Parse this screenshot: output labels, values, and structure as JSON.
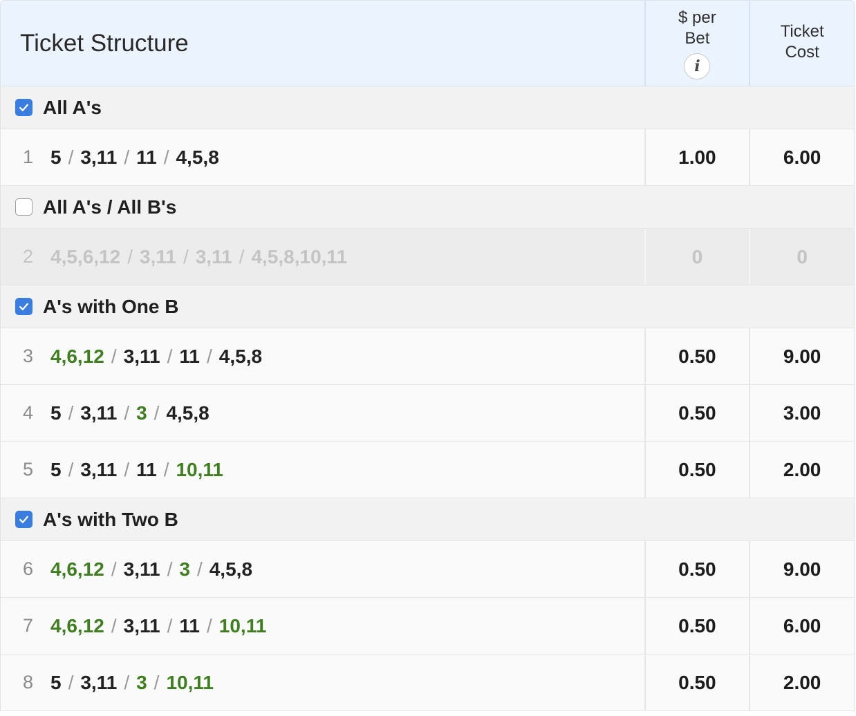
{
  "header": {
    "title": "Ticket Structure",
    "per_bet_line1": "$ per",
    "per_bet_line2": "Bet",
    "info_icon": "i",
    "cost_line1": "Ticket",
    "cost_line2": "Cost"
  },
  "colors": {
    "header_bg": "#ebf4fe",
    "checkbox_checked": "#3a7de0",
    "b_leg_green": "#3f7f1f"
  },
  "groups": [
    {
      "label": "All A's",
      "checked": true,
      "tickets": [
        {
          "num": "1",
          "legs": [
            {
              "t": "5",
              "b": false
            },
            {
              "t": "3,11",
              "b": false
            },
            {
              "t": "11",
              "b": false
            },
            {
              "t": "4,5,8",
              "b": false
            }
          ],
          "per_bet": "1.00",
          "cost": "6.00",
          "disabled": false
        }
      ]
    },
    {
      "label": "All A's / All B's",
      "checked": false,
      "tickets": [
        {
          "num": "2",
          "legs": [
            {
              "t": "4,5,6,12",
              "b": false
            },
            {
              "t": "3,11",
              "b": false
            },
            {
              "t": "3,11",
              "b": false
            },
            {
              "t": "4,5,8,10,11",
              "b": false
            }
          ],
          "per_bet": "0",
          "cost": "0",
          "disabled": true
        }
      ]
    },
    {
      "label": "A's with One B",
      "checked": true,
      "tickets": [
        {
          "num": "3",
          "legs": [
            {
              "t": "4,6,12",
              "b": true
            },
            {
              "t": "3,11",
              "b": false
            },
            {
              "t": "11",
              "b": false
            },
            {
              "t": "4,5,8",
              "b": false
            }
          ],
          "per_bet": "0.50",
          "cost": "9.00",
          "disabled": false
        },
        {
          "num": "4",
          "legs": [
            {
              "t": "5",
              "b": false
            },
            {
              "t": "3,11",
              "b": false
            },
            {
              "t": "3",
              "b": true
            },
            {
              "t": "4,5,8",
              "b": false
            }
          ],
          "per_bet": "0.50",
          "cost": "3.00",
          "disabled": false
        },
        {
          "num": "5",
          "legs": [
            {
              "t": "5",
              "b": false
            },
            {
              "t": "3,11",
              "b": false
            },
            {
              "t": "11",
              "b": false
            },
            {
              "t": "10,11",
              "b": true
            }
          ],
          "per_bet": "0.50",
          "cost": "2.00",
          "disabled": false
        }
      ]
    },
    {
      "label": "A's with Two B",
      "checked": true,
      "tickets": [
        {
          "num": "6",
          "legs": [
            {
              "t": "4,6,12",
              "b": true
            },
            {
              "t": "3,11",
              "b": false
            },
            {
              "t": "3",
              "b": true
            },
            {
              "t": "4,5,8",
              "b": false
            }
          ],
          "per_bet": "0.50",
          "cost": "9.00",
          "disabled": false
        },
        {
          "num": "7",
          "legs": [
            {
              "t": "4,6,12",
              "b": true
            },
            {
              "t": "3,11",
              "b": false
            },
            {
              "t": "11",
              "b": false
            },
            {
              "t": "10,11",
              "b": true
            }
          ],
          "per_bet": "0.50",
          "cost": "6.00",
          "disabled": false
        },
        {
          "num": "8",
          "legs": [
            {
              "t": "5",
              "b": false
            },
            {
              "t": "3,11",
              "b": false
            },
            {
              "t": "3",
              "b": true
            },
            {
              "t": "10,11",
              "b": true
            }
          ],
          "per_bet": "0.50",
          "cost": "2.00",
          "disabled": false
        }
      ]
    }
  ]
}
